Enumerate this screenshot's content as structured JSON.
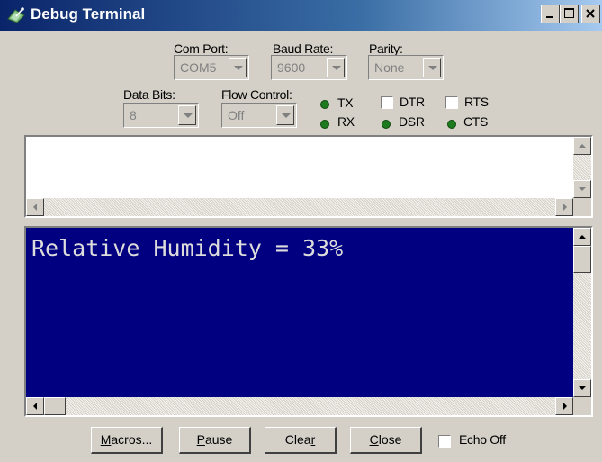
{
  "window": {
    "title": "Debug Terminal",
    "icon": "satellite-dish-icon",
    "controls": {
      "minimize": "minimize-icon",
      "maximize": "maximize-icon",
      "close": "close-icon"
    }
  },
  "settings": {
    "com_port": {
      "label": "Com Port:",
      "value": "COM5"
    },
    "baud_rate": {
      "label": "Baud Rate:",
      "value": "9600"
    },
    "parity": {
      "label": "Parity:",
      "value": "None"
    },
    "data_bits": {
      "label": "Data Bits:",
      "value": "8"
    },
    "flow_control": {
      "label": "Flow Control:",
      "value": "Off"
    }
  },
  "indicators": {
    "tx": "TX",
    "rx": "RX",
    "dsr": "DSR",
    "cts": "CTS",
    "led_color": "#1e7a1e"
  },
  "checkboxes": {
    "dtr": "DTR",
    "rts": "RTS"
  },
  "terminal": {
    "receive_text": "Relative Humidity = 33%",
    "background": "#000080",
    "foreground": "#dcdcdc"
  },
  "buttons": {
    "macros": {
      "mn": "M",
      "rest": "acros..."
    },
    "pause": {
      "mn": "P",
      "rest": "ause"
    },
    "clear": {
      "pre": "Clea",
      "mn": "r"
    },
    "close": {
      "mn": "C",
      "rest": "lose"
    }
  },
  "echo_off": "Echo Off"
}
